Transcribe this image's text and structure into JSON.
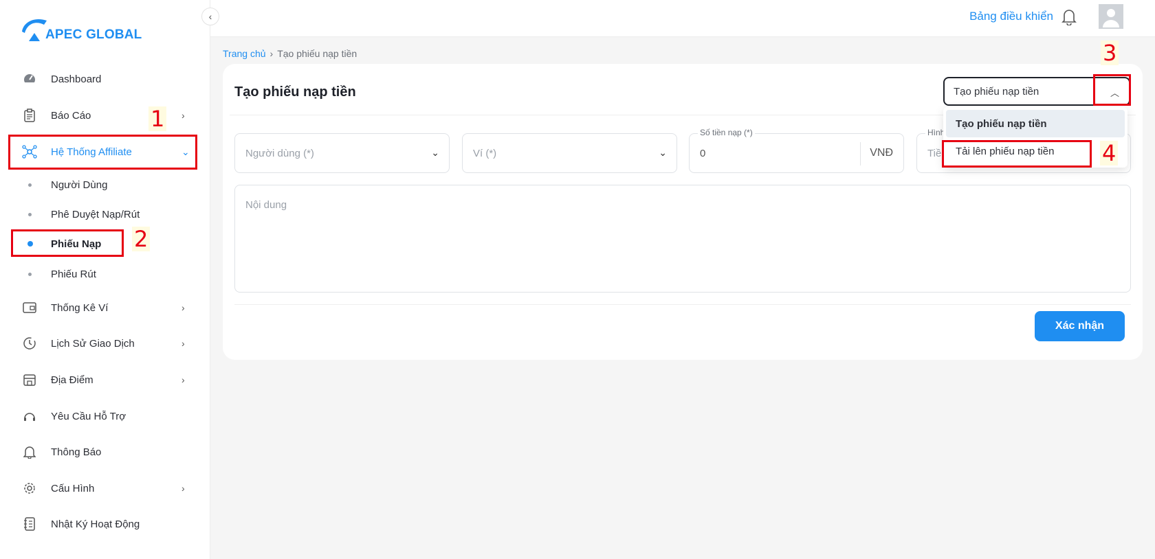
{
  "brand": {
    "name": "APEC GLOBAL",
    "color": "#1f8ef1"
  },
  "sidebar": {
    "items": [
      {
        "label": "Dashboard",
        "icon": "speedometer-icon"
      },
      {
        "label": "Báo Cáo",
        "icon": "clipboard-icon"
      },
      {
        "label": "Hệ Thống Affiliate",
        "icon": "network-icon"
      },
      {
        "label": "Thống Kê Ví",
        "icon": "wallet-icon"
      },
      {
        "label": "Lịch Sử Giao Dịch",
        "icon": "history-icon"
      },
      {
        "label": "Địa Điểm",
        "icon": "store-icon"
      },
      {
        "label": "Yêu Cầu Hỗ Trợ",
        "icon": "support-icon"
      },
      {
        "label": "Thông Báo",
        "icon": "bell-icon"
      },
      {
        "label": "Cấu Hình",
        "icon": "gear-icon"
      },
      {
        "label": "Nhật Ký Hoạt Động",
        "icon": "log-icon"
      }
    ],
    "sub_items": [
      {
        "label": "Người Dùng"
      },
      {
        "label": "Phê Duyệt Nạp/Rút"
      },
      {
        "label": "Phiếu Nạp"
      },
      {
        "label": "Phiếu Rút"
      }
    ]
  },
  "header": {
    "dashboard_link": "Bảng điều khiển"
  },
  "breadcrumb": {
    "home": "Trang chủ",
    "separator": "›",
    "current": "Tạo phiếu nạp tiền"
  },
  "form": {
    "title": "Tạo phiếu nạp tiền",
    "mode_select": {
      "value": "Tạo phiếu nạp tiền"
    },
    "mode_options": [
      "Tạo phiếu nạp tiền",
      "Tải lên phiếu nạp tiền"
    ],
    "user_field": {
      "placeholder": "Người dùng (*)"
    },
    "wallet_field": {
      "placeholder": "Ví (*)"
    },
    "amount_field": {
      "label": "Số tiền nạp (*)",
      "value": "0",
      "unit": "VNĐ"
    },
    "fourth_field": {
      "label": "Hình",
      "placeholder": "Tiề"
    },
    "content_field": {
      "placeholder": "Nội dung"
    },
    "submit_label": "Xác nhận"
  },
  "annotations": [
    "1",
    "2",
    "3",
    "4"
  ]
}
